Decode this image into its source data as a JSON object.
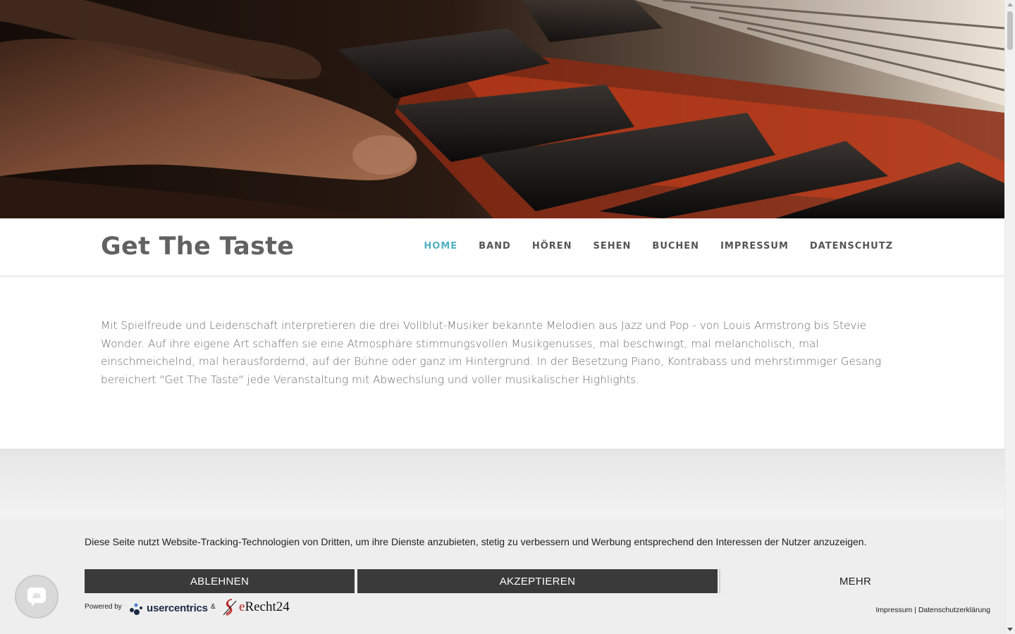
{
  "hero": {
    "description_icon": "piano-keys-photo"
  },
  "header": {
    "title": "Get The Taste",
    "nav": [
      {
        "label": "HOME",
        "active": true
      },
      {
        "label": "BAND",
        "active": false
      },
      {
        "label": "HÖREN",
        "active": false
      },
      {
        "label": "SEHEN",
        "active": false
      },
      {
        "label": "BUCHEN",
        "active": false
      },
      {
        "label": "IMPRESSUM",
        "active": false
      },
      {
        "label": "DATENSCHUTZ",
        "active": false
      }
    ]
  },
  "intro": {
    "text": "Mit Spielfreude und Leidenschaft interpretieren die drei Vollblut-Musiker bekannte Melodien aus Jazz und Pop - von Louis Armstrong bis Stevie Wonder. Auf ihre eigene Art schaffen sie eine Atmosphäre stimmungsvollen Musikgenusses, mal beschwingt, mal melancholisch, mal einschmeichelnd, mal herausfordernd, auf der Bühne oder ganz im Hintergrund. In der Besetzung Piano, Kontrabass und mehrstimmiger Gesang bereichert \"Get The Taste\" jede Veranstaltung mit Abwechslung und voller musikalischer Highlights."
  },
  "cookie": {
    "text": "Diese Seite nutzt Website-Tracking-Technologien von Dritten, um ihre Dienste anzubieten, stetig zu verbessern und Werbung entsprechend den Interessen der Nutzer anzuzeigen.",
    "reject_label": "ABLEHNEN",
    "accept_label": "AKZEPTIEREN",
    "more_label": "MEHR",
    "powered_by": "Powered by",
    "usercentrics": "usercentrics",
    "ampersand": "&",
    "erecht_e": "e",
    "erecht_rest": "Recht24",
    "links": "Impressum | Datenschutzerklärung"
  },
  "colors": {
    "accent": "#4fb2c0",
    "button_dark": "#3a3a3a",
    "banner_bg": "#eeeeee"
  }
}
